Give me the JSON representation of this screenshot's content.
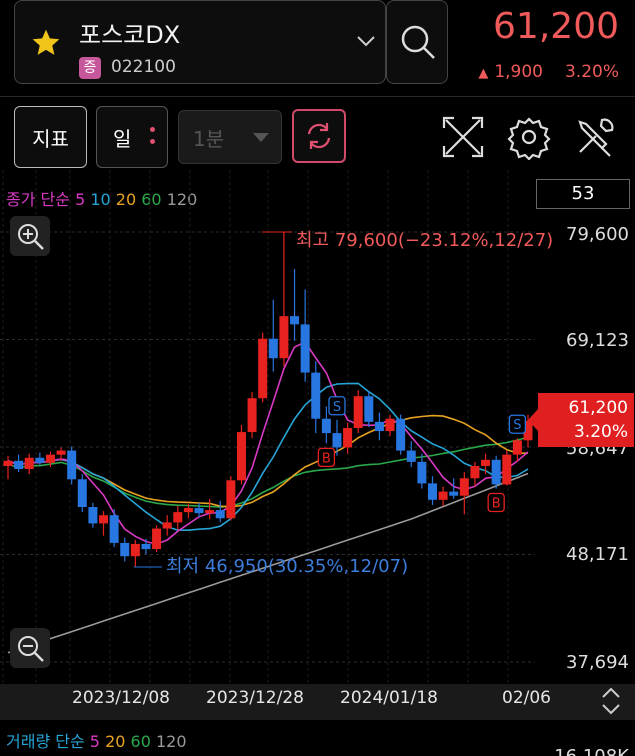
{
  "header": {
    "stock_name": "포스코DX",
    "market_badge": "증",
    "stock_code": "022100",
    "price": "61,200",
    "change": "1,900",
    "change_pct": "3.20%"
  },
  "toolbar": {
    "indicator_label": "지표",
    "period_label": "일",
    "minute_label": "1분"
  },
  "ma_legend": {
    "prefix": "종가 단순",
    "p5": "5",
    "p10": "10",
    "p20": "20",
    "p60": "60",
    "p120": "120"
  },
  "candle_count": "53",
  "chart_data": {
    "type": "candlestick",
    "y_ticks": [
      "79,600",
      "69,123",
      "58,647",
      "48,171",
      "37,694"
    ],
    "ylim": [
      37694,
      79600
    ],
    "x_ticks": [
      "2023/12/08",
      "2023/12/28",
      "2024/01/18",
      "02/06"
    ],
    "current_price": "61,200",
    "current_pct": "3.20%",
    "high_annotation": "최고 79,600(−23.12%,12/27)",
    "low_annotation": "최저 46,950(30.35%,12/07)",
    "signals": [
      {
        "type": "S",
        "index": 31
      },
      {
        "type": "B",
        "index": 30
      },
      {
        "type": "S",
        "index": 48
      },
      {
        "type": "B",
        "index": 46
      }
    ],
    "candles": [
      [
        56800,
        57800,
        55500,
        57300
      ],
      [
        57300,
        57900,
        56200,
        56500
      ],
      [
        56500,
        58000,
        56000,
        57600
      ],
      [
        57600,
        58100,
        56900,
        57100
      ],
      [
        57100,
        58200,
        56700,
        57900
      ],
      [
        57900,
        58600,
        57300,
        58300
      ],
      [
        58300,
        58700,
        55000,
        55500
      ],
      [
        55500,
        56000,
        52300,
        52800
      ],
      [
        52800,
        53200,
        50800,
        51200
      ],
      [
        51200,
        52400,
        50000,
        52000
      ],
      [
        52000,
        52600,
        48900,
        49300
      ],
      [
        49300,
        49800,
        47500,
        48000
      ],
      [
        48000,
        49600,
        46950,
        49200
      ],
      [
        49200,
        49700,
        48200,
        48700
      ],
      [
        48700,
        51000,
        48400,
        50700
      ],
      [
        50700,
        52000,
        50000,
        51300
      ],
      [
        51300,
        52900,
        50600,
        52300
      ],
      [
        52300,
        53100,
        51700,
        52700
      ],
      [
        52700,
        53200,
        51800,
        52200
      ],
      [
        52200,
        53600,
        51600,
        52500
      ],
      [
        52500,
        53400,
        51300,
        51700
      ],
      [
        51700,
        55800,
        51500,
        55400
      ],
      [
        55400,
        60800,
        55000,
        60100
      ],
      [
        60100,
        64000,
        59500,
        63400
      ],
      [
        63400,
        69800,
        63000,
        69200
      ],
      [
        69200,
        73000,
        66000,
        67300
      ],
      [
        67300,
        79600,
        66500,
        71400
      ],
      [
        71400,
        76000,
        69000,
        70600
      ],
      [
        70600,
        74000,
        65000,
        65900
      ],
      [
        65900,
        67000,
        60000,
        61400
      ],
      [
        61400,
        62600,
        59000,
        60000
      ],
      [
        60000,
        61300,
        57800,
        58600
      ],
      [
        58600,
        61000,
        58000,
        60500
      ],
      [
        60500,
        64200,
        60000,
        63600
      ],
      [
        63600,
        64100,
        60600,
        61100
      ],
      [
        61100,
        62000,
        59300,
        60200
      ],
      [
        60200,
        61800,
        59700,
        61400
      ],
      [
        61400,
        61800,
        57900,
        58300
      ],
      [
        58300,
        59200,
        56700,
        57200
      ],
      [
        57200,
        58000,
        54600,
        55100
      ],
      [
        55100,
        55800,
        53000,
        53500
      ],
      [
        53500,
        54800,
        52900,
        54300
      ],
      [
        54300,
        55600,
        53600,
        53900
      ],
      [
        53900,
        56200,
        52100,
        55600
      ],
      [
        55600,
        57200,
        54800,
        56800
      ],
      [
        56800,
        58000,
        56000,
        57400
      ],
      [
        57400,
        57800,
        54600,
        55000
      ],
      [
        55000,
        58300,
        54900,
        57900
      ],
      [
        57900,
        59500,
        57200,
        59300
      ],
      [
        59300,
        61800,
        58600,
        61200
      ]
    ]
  },
  "xaxis_labels": [
    "2023/12/08",
    "2023/12/28",
    "2024/01/18",
    "02/06"
  ],
  "volume_legend": {
    "prefix": "거래량 단순",
    "p5": "5",
    "p20": "20",
    "p60": "60",
    "p120": "120"
  },
  "volume_y_top": "16,108K",
  "colors": {
    "up": "#e8231f",
    "down": "#2876e0",
    "ma5": "#d83ac4",
    "ma10": "#27a5d6",
    "ma20": "#e8a321",
    "ma60": "#2aa84a",
    "ma120": "#9a9a9a",
    "accent": "#f05a5a"
  }
}
